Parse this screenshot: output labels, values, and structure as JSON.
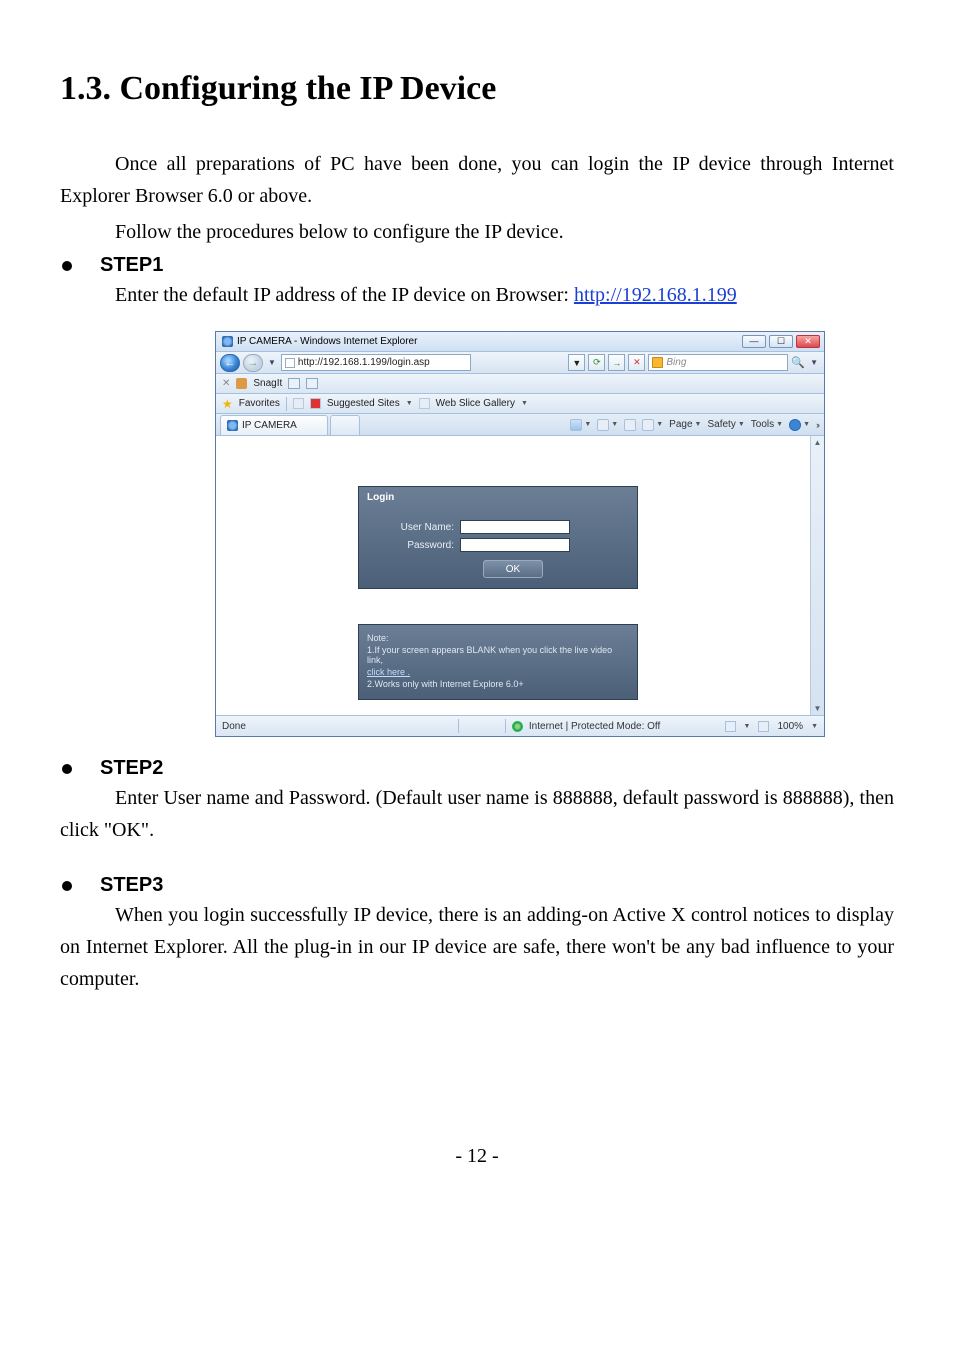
{
  "section_title": "1.3. Configuring the IP Device",
  "intro_para_1": "Once all preparations of PC have been done, you can login the IP device through Internet Explorer Browser 6.0 or above.",
  "intro_para_2": "Follow the procedures below to configure the IP device.",
  "step1_label": "STEP1",
  "step1_text_prefix": "Enter the default IP address of the IP device on Browser: ",
  "step1_url": "http://192.168.1.199",
  "step2_label": "STEP2",
  "step2_text": "Enter User name and Password. (Default user name is 888888, default password is 888888), then click \"OK\".",
  "step3_label": "STEP3",
  "step3_text": "When you login successfully IP device, there is an adding-on Active X control notices to display on Internet Explorer. All the plug-in in our IP device are safe, there won't be any bad influence to your computer.",
  "page_number": "- 12 -",
  "screenshot": {
    "window_title": "IP CAMERA - Windows Internet Explorer",
    "address_url": "http://192.168.1.199/login.asp",
    "search_provider": "Bing",
    "toolbar_snagit": "SnagIt",
    "favorites_label": "Favorites",
    "suggested_sites": "Suggested Sites",
    "web_slice": "Web Slice Gallery",
    "tab_title": "IP CAMERA",
    "cmd_page": "Page",
    "cmd_safety": "Safety",
    "cmd_tools": "Tools",
    "login_heading": "Login",
    "user_name_label": "User Name:",
    "password_label": "Password:",
    "ok_button": "OK",
    "note_heading": "Note:",
    "note_line1": "1.If your screen appears BLANK when you click the live video link,",
    "note_link": "click here .",
    "note_line2": "2.Works only with Internet Explore 6.0+",
    "status_done": "Done",
    "status_zone": "Internet | Protected Mode: Off",
    "status_zoom": "100%"
  }
}
